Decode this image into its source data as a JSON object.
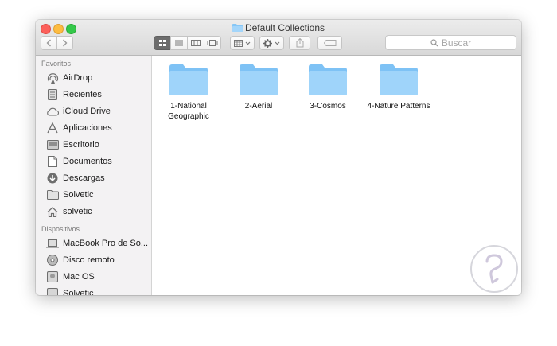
{
  "window": {
    "title": "Default Collections"
  },
  "toolbar": {
    "view_icons": "icon-view-icon",
    "search_placeholder": "Buscar"
  },
  "sidebar": {
    "favorites_header": "Favoritos",
    "favorites": [
      {
        "label": "AirDrop",
        "icon": "airdrop-icon"
      },
      {
        "label": "Recientes",
        "icon": "recents-icon"
      },
      {
        "label": "iCloud Drive",
        "icon": "cloud-icon"
      },
      {
        "label": "Aplicaciones",
        "icon": "applications-icon"
      },
      {
        "label": "Escritorio",
        "icon": "desktop-icon"
      },
      {
        "label": "Documentos",
        "icon": "document-icon"
      },
      {
        "label": "Descargas",
        "icon": "download-icon"
      },
      {
        "label": "Solvetic",
        "icon": "folder-icon"
      },
      {
        "label": "solvetic",
        "icon": "home-icon"
      }
    ],
    "devices_header": "Dispositivos",
    "devices": [
      {
        "label": "MacBook Pro de So...",
        "icon": "laptop-icon"
      },
      {
        "label": "Disco remoto",
        "icon": "disc-icon"
      },
      {
        "label": "Mac OS",
        "icon": "drive-icon"
      },
      {
        "label": "Solvetic",
        "icon": "drive-icon"
      }
    ]
  },
  "files": [
    {
      "name": "1-National Geographic"
    },
    {
      "name": "2-Aerial"
    },
    {
      "name": "3-Cosmos"
    },
    {
      "name": "4-Nature Patterns"
    }
  ],
  "colors": {
    "folder_light": "#9fd4fa",
    "folder_dark": "#7ec2f5",
    "sidebar_bg": "#f3f2f3"
  }
}
